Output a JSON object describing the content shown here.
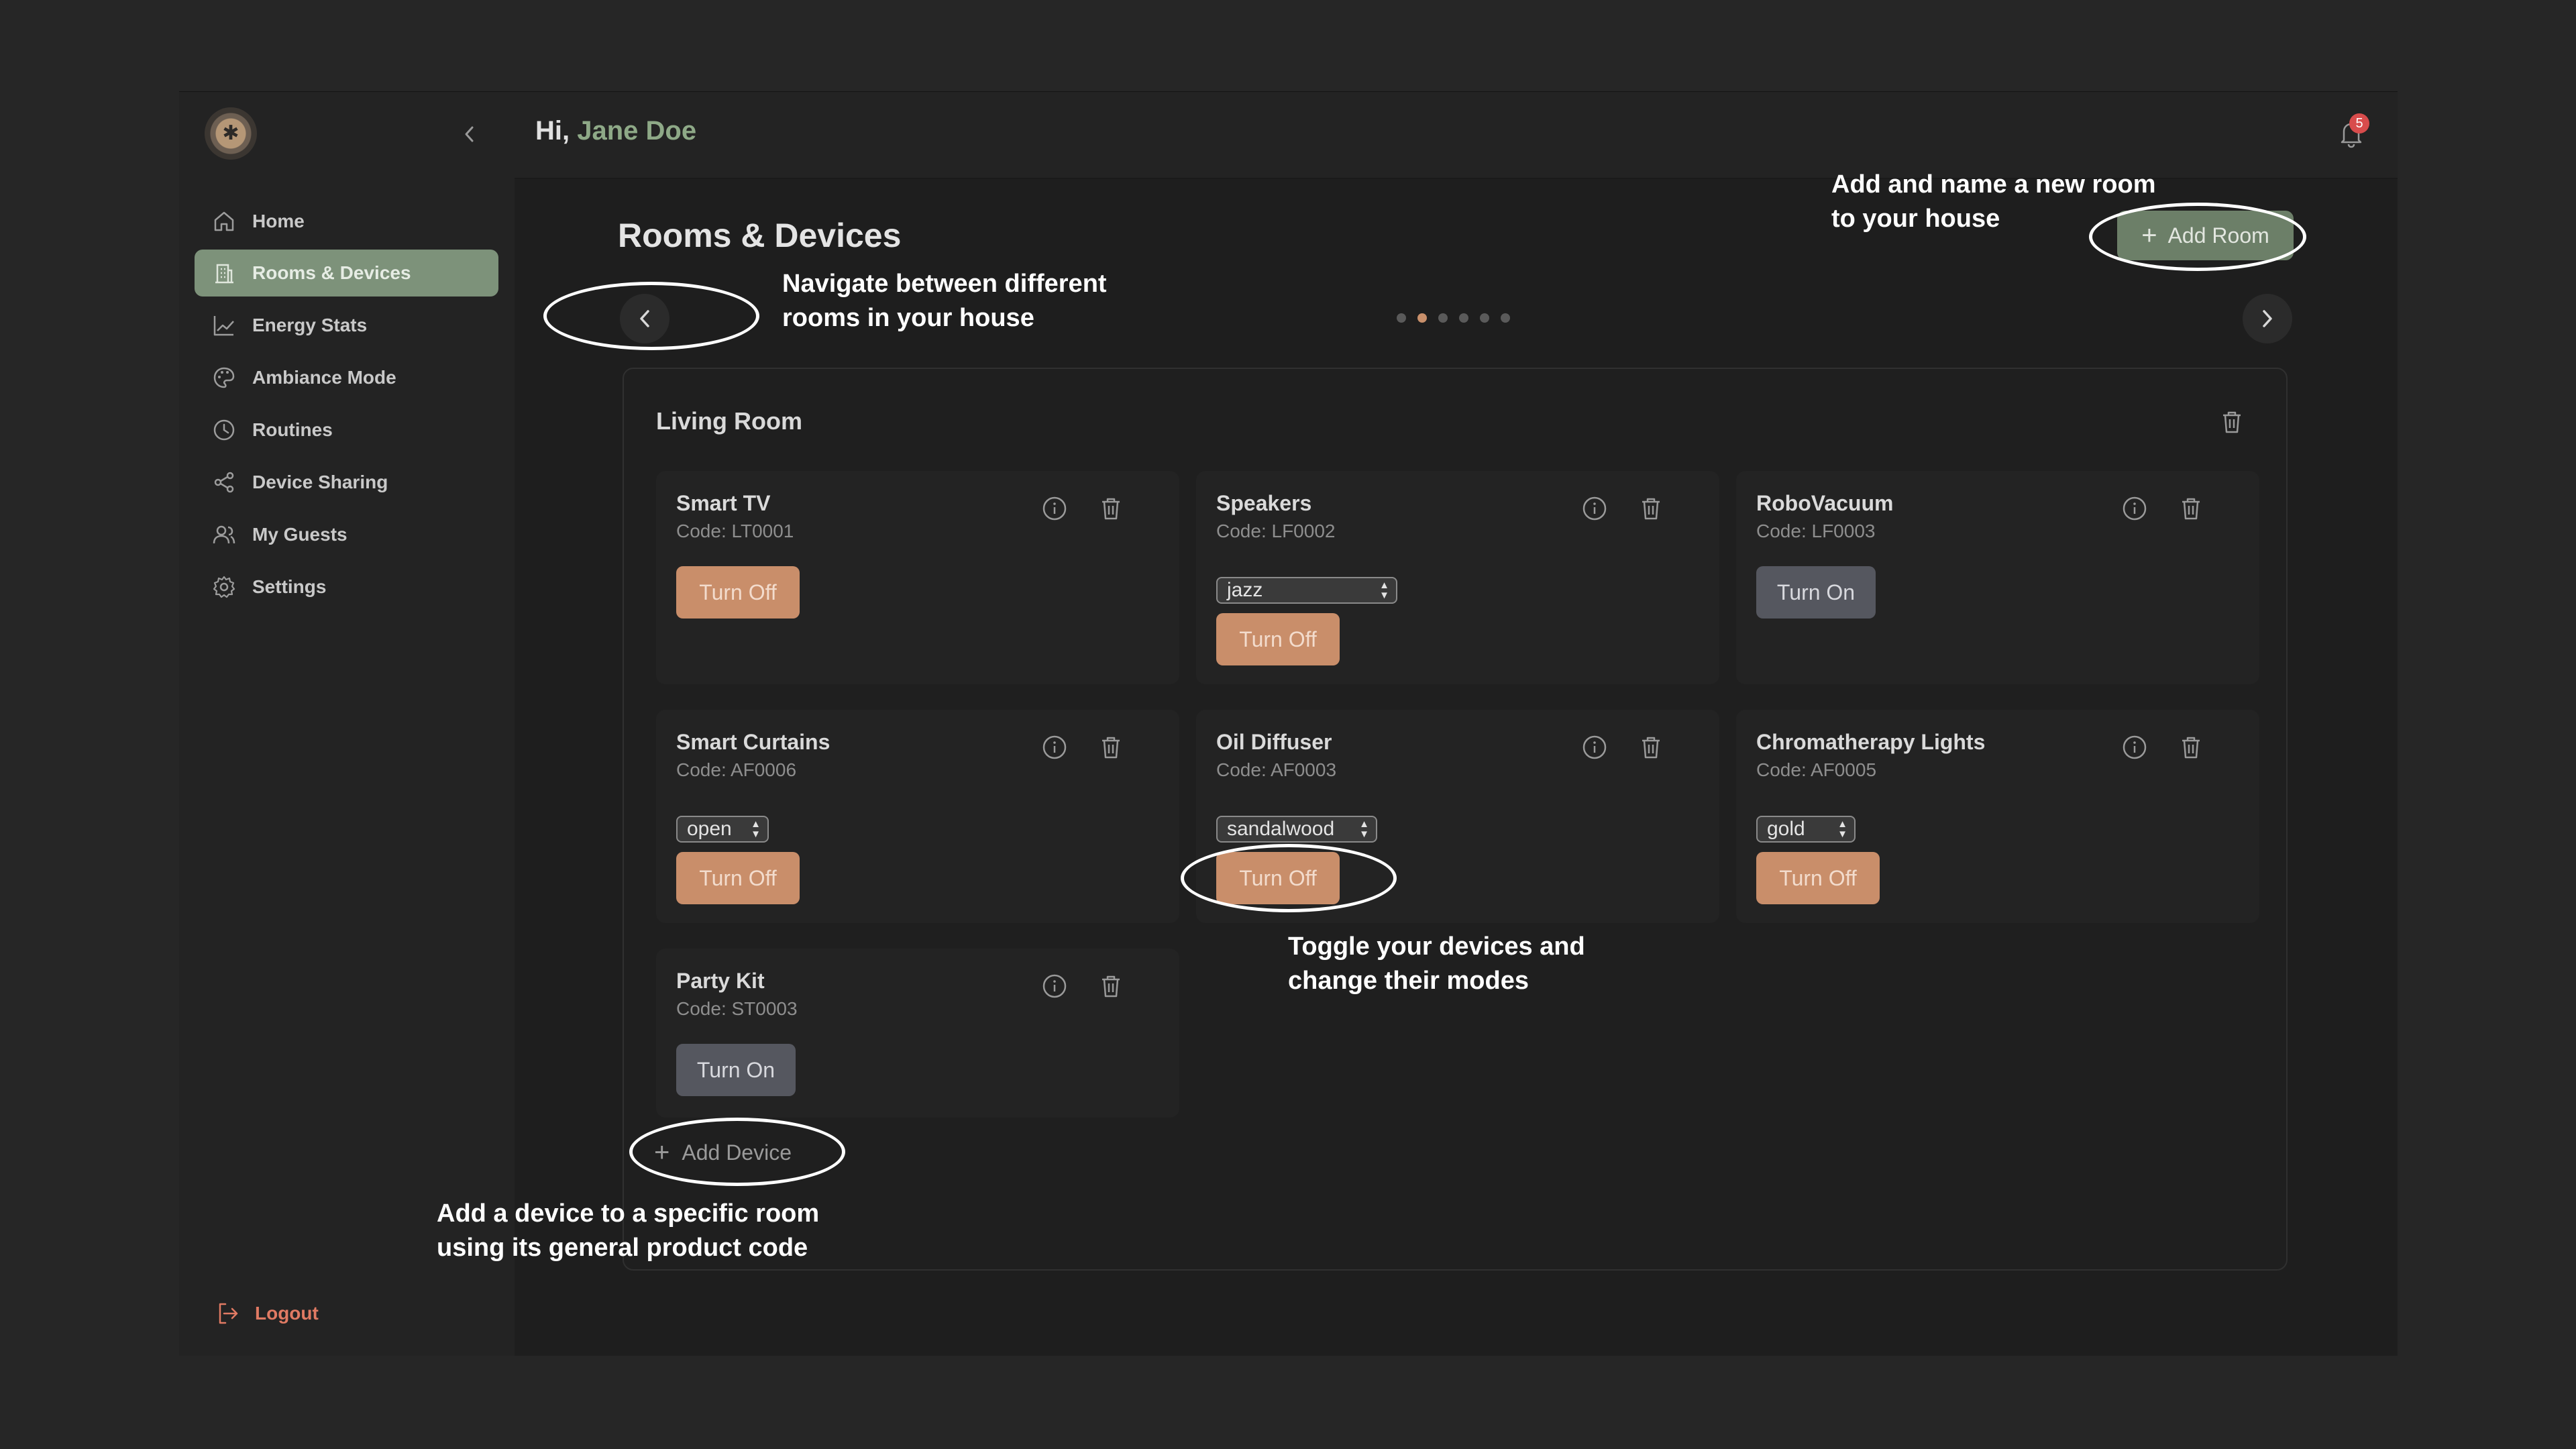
{
  "header": {
    "greeting_prefix": "Hi,",
    "user_name": "Jane Doe",
    "notification_count": "5"
  },
  "sidebar": {
    "items": [
      {
        "label": "Home",
        "icon": "home-icon"
      },
      {
        "label": "Rooms & Devices",
        "icon": "building-icon",
        "active": true
      },
      {
        "label": "Energy Stats",
        "icon": "chart-line-icon"
      },
      {
        "label": "Ambiance Mode",
        "icon": "palette-icon"
      },
      {
        "label": "Routines",
        "icon": "clock-icon"
      },
      {
        "label": "Device Sharing",
        "icon": "share-icon"
      },
      {
        "label": "My Guests",
        "icon": "users-icon"
      },
      {
        "label": "Settings",
        "icon": "gear-icon"
      }
    ],
    "logout_label": "Logout"
  },
  "page": {
    "title": "Rooms & Devices",
    "add_room_label": "Add Room",
    "carousel": {
      "total": 6,
      "active_index": 1
    }
  },
  "room": {
    "name": "Living Room",
    "add_device_label": "Add Device",
    "devices": [
      {
        "name": "Smart TV",
        "code": "Code: LT0001",
        "button": "Turn Off",
        "state": "on"
      },
      {
        "name": "Speakers",
        "code": "Code: LF0002",
        "mode": "jazz",
        "button": "Turn Off",
        "state": "on"
      },
      {
        "name": "RoboVacuum",
        "code": "Code: LF0003",
        "button": "Turn On",
        "state": "off"
      },
      {
        "name": "Smart Curtains",
        "code": "Code: AF0006",
        "mode": "open",
        "button": "Turn Off",
        "state": "on"
      },
      {
        "name": "Oil Diffuser",
        "code": "Code: AF0003",
        "mode": "sandalwood",
        "button": "Turn Off",
        "state": "on"
      },
      {
        "name": "Chromatherapy Lights",
        "code": "Code: AF0005",
        "mode": "gold",
        "button": "Turn Off",
        "state": "on"
      },
      {
        "name": "Party Kit",
        "code": "Code: ST0003",
        "button": "Turn On",
        "state": "off"
      }
    ]
  },
  "annotations": {
    "navigate": [
      "Navigate between different",
      "rooms in your house"
    ],
    "add_room": [
      "Add and name a new room",
      "to your house"
    ],
    "toggle": [
      "Toggle your devices and",
      "change their modes"
    ],
    "add_device": [
      "Add a device to a specific room",
      "using its general product code"
    ]
  },
  "colors": {
    "accent_green": "#7d927a",
    "turn_off_button": "#c98e6a",
    "turn_on_button": "#55575f",
    "logout": "#e07a63",
    "notification_badge": "#d84c4c"
  }
}
